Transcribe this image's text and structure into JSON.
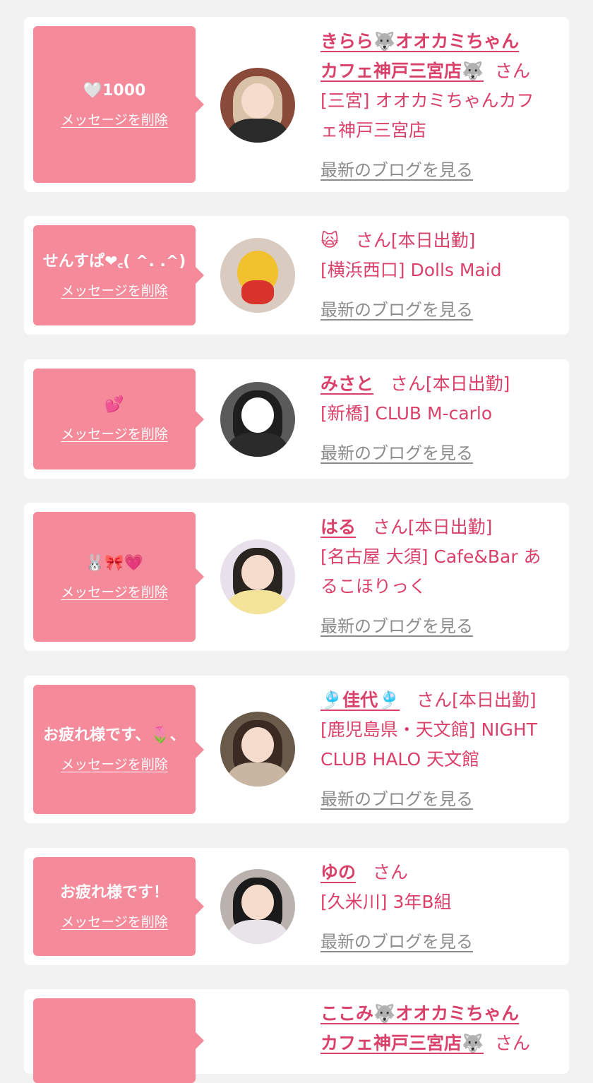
{
  "san_label": "さん",
  "delete_label": "メッセージを削除",
  "blog_label": "最新のブログを見る",
  "cards": [
    {
      "message": "🤍1000",
      "name": "きらら🐺オオカミちゃんカフェ神戸三宮店🐺",
      "name_line1": "きらら🐺オオカミちゃん",
      "name_line2": "カフェ神戸三宮店🐺",
      "status": "",
      "shop_line1": "[三宮] オオカミちゃんカフ",
      "shop_line2": "ェ神戸三宮店"
    },
    {
      "message": "せんすぱ❤︎꜀( ^. .^)",
      "name": "🙀",
      "status": "[本日出勤]",
      "shop_line1": "[横浜西口] Dolls Maid"
    },
    {
      "message": "💕",
      "name": "みさと",
      "status": "[本日出勤]",
      "shop_line1": "[新橋] CLUB M-carlo"
    },
    {
      "message": "🐰🎀💗",
      "name": "はる",
      "status": "[本日出勤]",
      "shop_line1": "[名古屋 大須] Cafe&Bar あ",
      "shop_line2": "るこほりっく"
    },
    {
      "message": "お疲れ様です、🌷、",
      "name": "🎐佳代🎐",
      "status": "[本日出勤]",
      "shop_line1": "[鹿児島県・天文館] NIGHT",
      "shop_line2": "CLUB HALO 天文館"
    },
    {
      "message": "お疲れ様です！",
      "name": "ゆの",
      "status": "",
      "shop_line1": "[久米川] 3年B組"
    },
    {
      "message": "",
      "name": "ここみ🐺オオカミちゃんカフェ神戸三宮店🐺",
      "name_line1": "ここみ🐺オオカミちゃん",
      "name_line2": "カフェ神戸三宮店🐺",
      "status": ""
    }
  ]
}
